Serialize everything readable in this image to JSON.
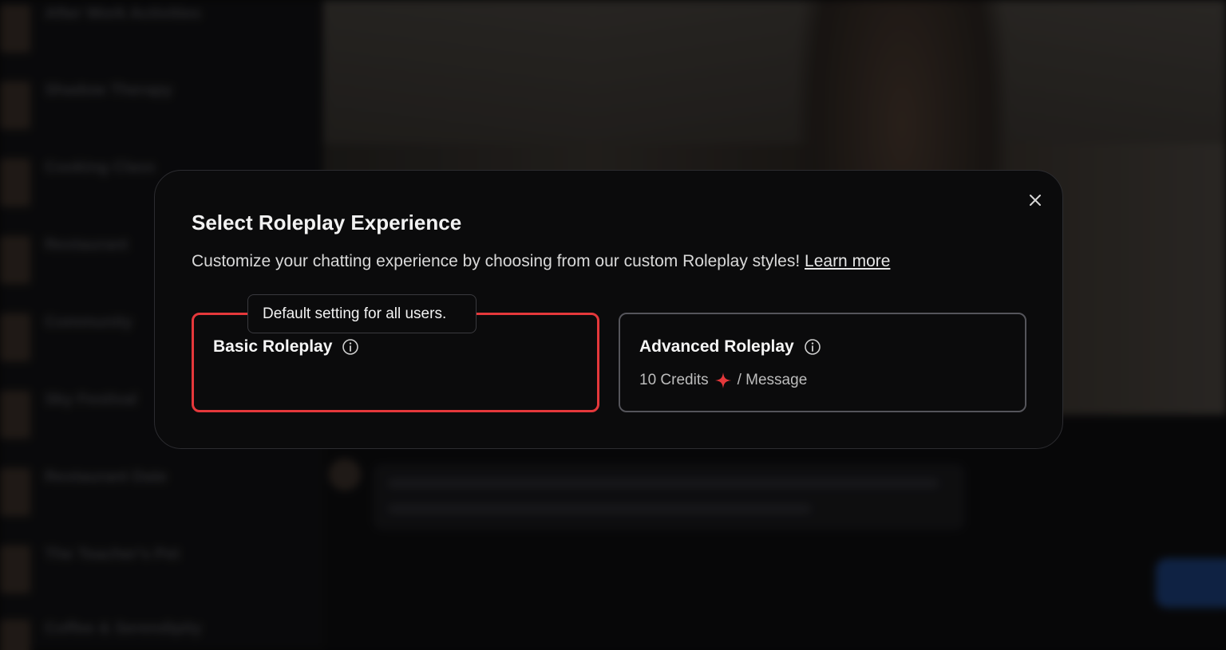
{
  "sidebar": {
    "items": [
      {
        "title": "After Work Activities",
        "subtitle": ""
      },
      {
        "title": "Shadow Therapy",
        "subtitle": ""
      },
      {
        "title": "Cooking Class",
        "subtitle": ""
      },
      {
        "title": "Restaurant",
        "subtitle": ""
      },
      {
        "title": "Community",
        "subtitle": ""
      },
      {
        "title": "Sky Festival",
        "subtitle": ""
      },
      {
        "title": "Restaurant Date",
        "subtitle": ""
      },
      {
        "title": "The Teacher's Pet",
        "subtitle": ""
      },
      {
        "title": "Coffee & Serendipity",
        "subtitle": ""
      }
    ]
  },
  "modal": {
    "title": "Select Roleplay Experience",
    "description": "Customize your chatting experience by choosing from our custom Roleplay styles!",
    "learn_more": "Learn more",
    "close_icon": "close-icon",
    "tooltip": "Default setting for all users.",
    "options": {
      "basic": {
        "label": "Basic Roleplay",
        "selected": true
      },
      "advanced": {
        "label": "Advanced Roleplay",
        "cost": "10 Credits",
        "cost_suffix": "/ Message"
      }
    },
    "colors": {
      "accent": "#e5383b",
      "selected_border": "#e5383b",
      "card_border": "#55555b"
    }
  }
}
